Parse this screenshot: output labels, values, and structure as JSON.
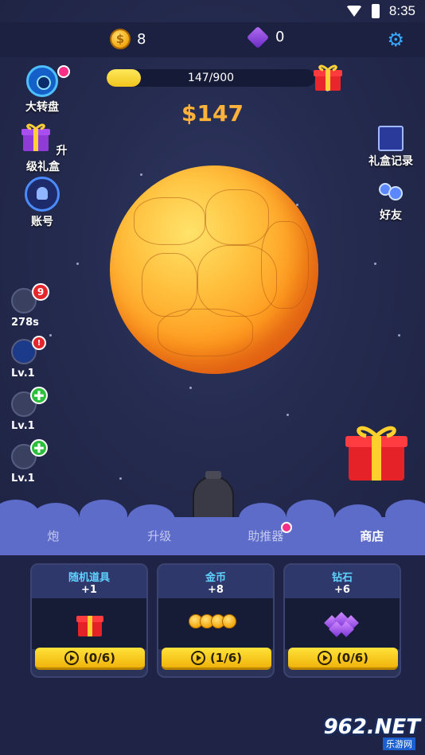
{
  "status_bar": {
    "time": "8:35"
  },
  "currency": {
    "coins": "8",
    "gems": "0"
  },
  "progress": {
    "text": "147/900",
    "fraction": 0.163
  },
  "money": "$147",
  "left_menu": {
    "wheel": "大转盘",
    "upgrade_gift": "升级礼盒",
    "account": "账号"
  },
  "right_menu": {
    "gift_record": "礼盒记录",
    "friends": "好友"
  },
  "stats": [
    {
      "label": "278s",
      "badge": "9",
      "icon": "bomb-icon"
    },
    {
      "label": "Lv.1",
      "badge": "!",
      "icon": "rocket-icon"
    },
    {
      "label": "Lv.1",
      "badge": "✚",
      "icon": "meteor-icon"
    },
    {
      "label": "Lv.1",
      "badge": "✚",
      "icon": "missile-icon"
    }
  ],
  "tabs": [
    {
      "label": "炮"
    },
    {
      "label": "升级"
    },
    {
      "label": "助推器"
    },
    {
      "label": "商店"
    }
  ],
  "shop_items": [
    {
      "title": "随机道具",
      "amount": "+1",
      "button": "(0/6)"
    },
    {
      "title": "金币",
      "amount": "+8",
      "button": "(1/6)"
    },
    {
      "title": "钻石",
      "amount": "+6",
      "button": "(0/6)"
    }
  ],
  "watermark": {
    "main": "962.NET",
    "sub": "乐游网"
  },
  "colors": {
    "accent": "#39a8ff",
    "tab_bar": "#5d6bc9",
    "button": "#f0c51d",
    "money": "#ffb23a"
  }
}
